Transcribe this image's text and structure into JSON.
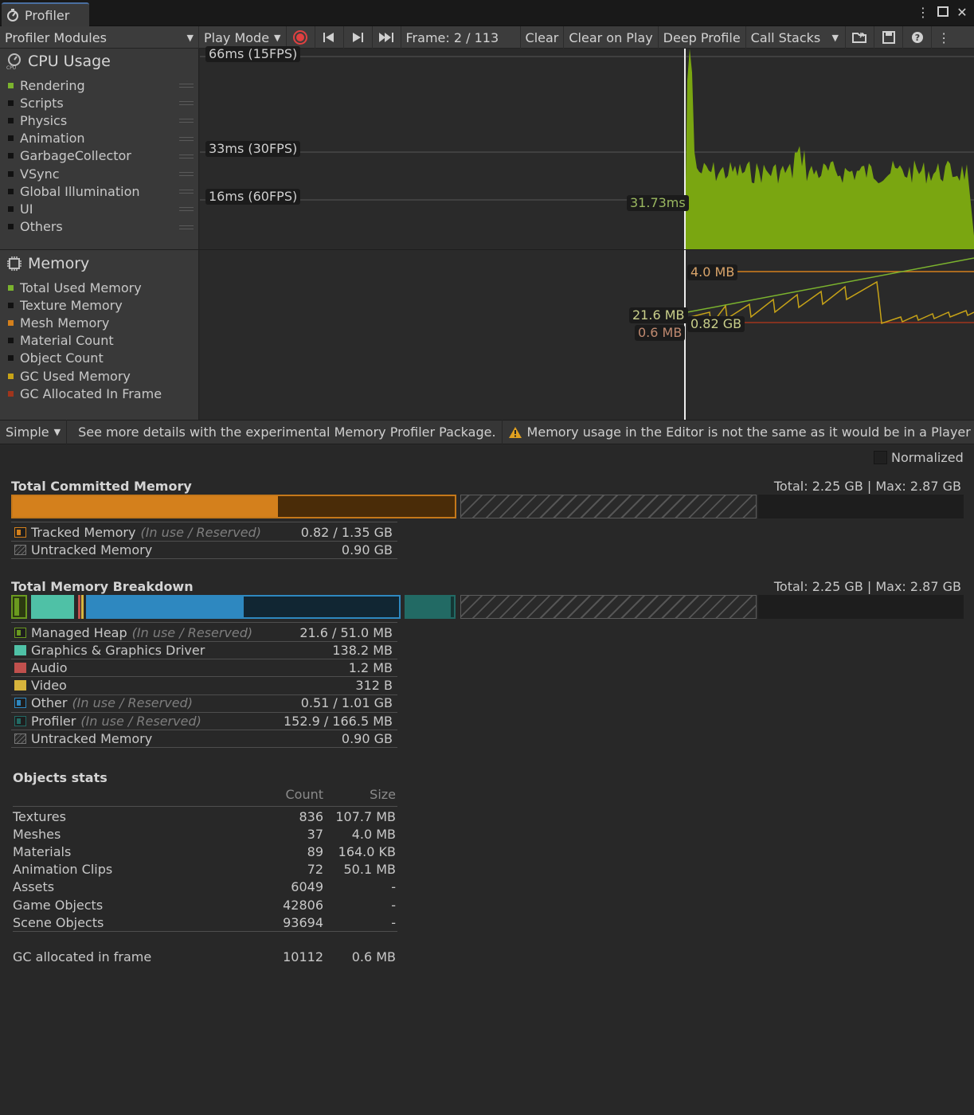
{
  "window": {
    "title": "Profiler"
  },
  "toolbar": {
    "modules": "Profiler Modules",
    "play_mode": "Play Mode",
    "frame": "Frame: 2 / 113",
    "clear": "Clear",
    "clear_on_play": "Clear on Play",
    "deep_profile": "Deep Profile",
    "call_stacks": "Call Stacks"
  },
  "cpu": {
    "title": "CPU Usage",
    "legend": [
      {
        "label": "Rendering",
        "color": "#7bb32e"
      },
      {
        "label": "Scripts",
        "color": "#111111"
      },
      {
        "label": "Physics",
        "color": "#111111"
      },
      {
        "label": "Animation",
        "color": "#111111"
      },
      {
        "label": "GarbageCollector",
        "color": "#111111"
      },
      {
        "label": "VSync",
        "color": "#111111"
      },
      {
        "label": "Global Illumination",
        "color": "#111111"
      },
      {
        "label": "UI",
        "color": "#111111"
      },
      {
        "label": "Others",
        "color": "#111111"
      }
    ],
    "lines": [
      "66ms (15FPS)",
      "33ms (30FPS)",
      "16ms (60FPS)"
    ],
    "value_label": "31.73ms"
  },
  "memory": {
    "title": "Memory",
    "legend": [
      {
        "label": "Total Used Memory",
        "color": "#7bb32e"
      },
      {
        "label": "Texture Memory",
        "color": "#111111"
      },
      {
        "label": "Mesh Memory",
        "color": "#d4801c"
      },
      {
        "label": "Material Count",
        "color": "#111111"
      },
      {
        "label": "Object Count",
        "color": "#111111"
      },
      {
        "label": "GC Used Memory",
        "color": "#c7a317"
      },
      {
        "label": "GC Allocated In Frame",
        "color": "#a0351c"
      }
    ],
    "labels": {
      "a": "4.0 MB",
      "b": "21.6 MB",
      "c": "0.82 GB",
      "d": "0.6 MB"
    }
  },
  "details_toolbar": {
    "mode": "Simple",
    "link": "See more details with the experimental Memory Profiler Package.",
    "warning": "Memory usage in the Editor is not the same as it would be in a Player"
  },
  "normalized": "Normalized",
  "committed": {
    "title": "Total Committed Memory",
    "totals": "Total: 2.25 GB | Max: 2.87 GB",
    "tracked_fraction": 0.6,
    "rows": [
      {
        "label": "Tracked Memory",
        "note": "(In use / Reserved)",
        "value": "0.82 / 1.35 GB",
        "color": "#d4801c"
      },
      {
        "label": "Untracked Memory",
        "note": "",
        "value": "0.90 GB",
        "color": "none"
      }
    ]
  },
  "breakdown": {
    "title": "Total Memory Breakdown",
    "totals": "Total: 2.25 GB | Max: 2.87 GB",
    "other_fraction": 0.5,
    "rows": [
      {
        "label": "Managed Heap",
        "note": "(In use / Reserved)",
        "value": "21.6 / 51.0 MB",
        "color": "#6a9a1f"
      },
      {
        "label": "Graphics & Graphics Driver",
        "note": "",
        "value": "138.2 MB",
        "color": "#4fc1a6"
      },
      {
        "label": "Audio",
        "note": "",
        "value": "1.2 MB",
        "color": "#c0504d"
      },
      {
        "label": "Video",
        "note": "",
        "value": "312 B",
        "color": "#d7b43c"
      },
      {
        "label": "Other",
        "note": "(In use / Reserved)",
        "value": "0.51 / 1.01 GB",
        "color": "#2e88c0"
      },
      {
        "label": "Profiler",
        "note": "(In use / Reserved)",
        "value": "152.9 / 166.5 MB",
        "color": "#226a64"
      },
      {
        "label": "Untracked Memory",
        "note": "",
        "value": "0.90 GB",
        "color": "none"
      }
    ]
  },
  "objects": {
    "title": "Objects stats",
    "count_header": "Count",
    "size_header": "Size",
    "rows": [
      {
        "label": "Textures",
        "count": "836",
        "size": "107.7 MB"
      },
      {
        "label": "Meshes",
        "count": "37",
        "size": "4.0 MB"
      },
      {
        "label": "Materials",
        "count": "89",
        "size": "164.0 KB"
      },
      {
        "label": "Animation Clips",
        "count": "72",
        "size": "50.1 MB"
      },
      {
        "label": "Assets",
        "count": "6049",
        "size": "-"
      },
      {
        "label": "Game Objects",
        "count": "42806",
        "size": "-"
      },
      {
        "label": "Scene Objects",
        "count": "93694",
        "size": "-"
      }
    ],
    "gc": {
      "label": "GC allocated in frame",
      "count": "10112",
      "size": "0.6 MB"
    }
  }
}
